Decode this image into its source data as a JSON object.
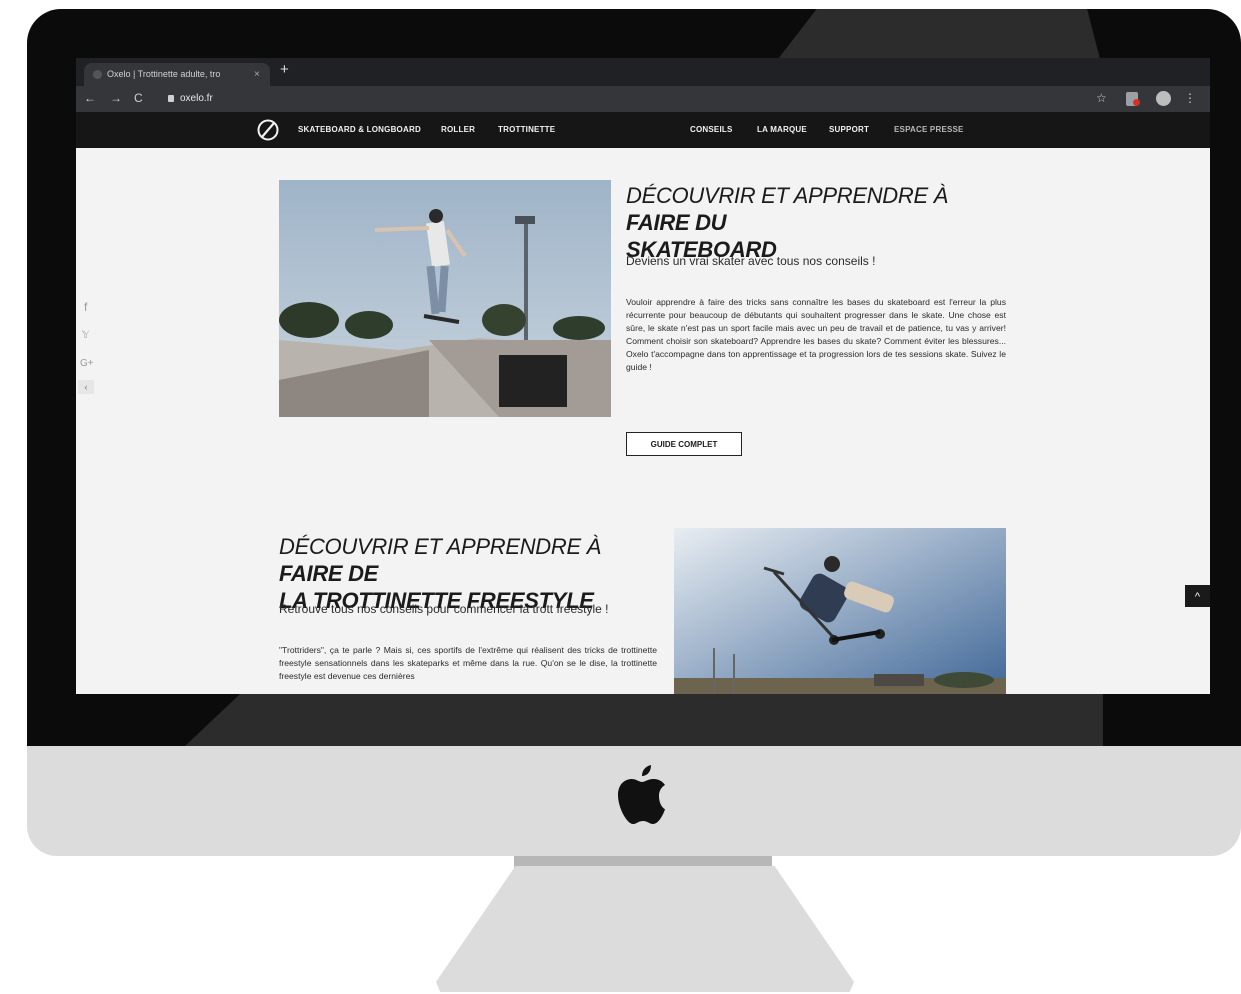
{
  "browser": {
    "tab_title": "Oxelo | Trottinette adulte, tro",
    "tab_close": "×",
    "new_tab": "+",
    "url": "oxelo.fr",
    "back": "←",
    "forward": "→",
    "reload": "C",
    "star": "☆",
    "menu": "⋮"
  },
  "site_nav": {
    "left": [
      "SKATEBOARD & LONGBOARD",
      "ROLLER",
      "TROTTINETTE"
    ],
    "right": [
      "CONSEILS",
      "LA MARQUE",
      "SUPPORT",
      "ESPACE PRESSE"
    ]
  },
  "social": {
    "facebook": "f",
    "twitter": "𝕐",
    "google": "G+",
    "toggle": "‹"
  },
  "section1": {
    "title_regular": "DÉCOUVRIR ET APPRENDRE À ",
    "title_bold_1": "FAIRE DU",
    "title_bold_2": "SKATEBOARD",
    "subtitle": "Deviens un vrai skater avec tous nos conseils !",
    "body": "Vouloir apprendre à faire des tricks sans connaître les bases du skateboard est l'erreur la plus récurrente pour beaucoup de débutants qui souhaitent progresser dans le skate. Une chose est sûre, le skate n'est pas un sport facile mais avec un peu de travail et de patience, tu vas y arriver! Comment choisir son skateboard? Apprendre les bases du skate? Comment éviter les blessures... Oxelo t'accompagne dans ton apprentissage et ta progression lors de tes sessions skate. Suivez le guide !",
    "button": "GUIDE COMPLET"
  },
  "section2": {
    "title_regular": "DÉCOUVRIR ET APPRENDRE À ",
    "title_bold_1": "FAIRE DE",
    "title_bold_2": "LA TROTTINETTE FREESTYLE",
    "subtitle": "Retrouve tous nos conseils pour commencer la trott freestyle !",
    "body": "\"Trottriders\", ça te parle ? Mais si, ces sportifs de l'extrême qui réalisent des tricks de trottinette freestyle sensationnels dans les skateparks et même dans la rue. Qu'on se le dise, la trottinette freestyle est devenue ces dernières"
  },
  "scroll_top": "^",
  "colors": {
    "bezel": "#0b0b0b",
    "chin": "#dcdcdc",
    "site_nav_bg": "#161616",
    "page_bg": "#f3f3f3"
  }
}
